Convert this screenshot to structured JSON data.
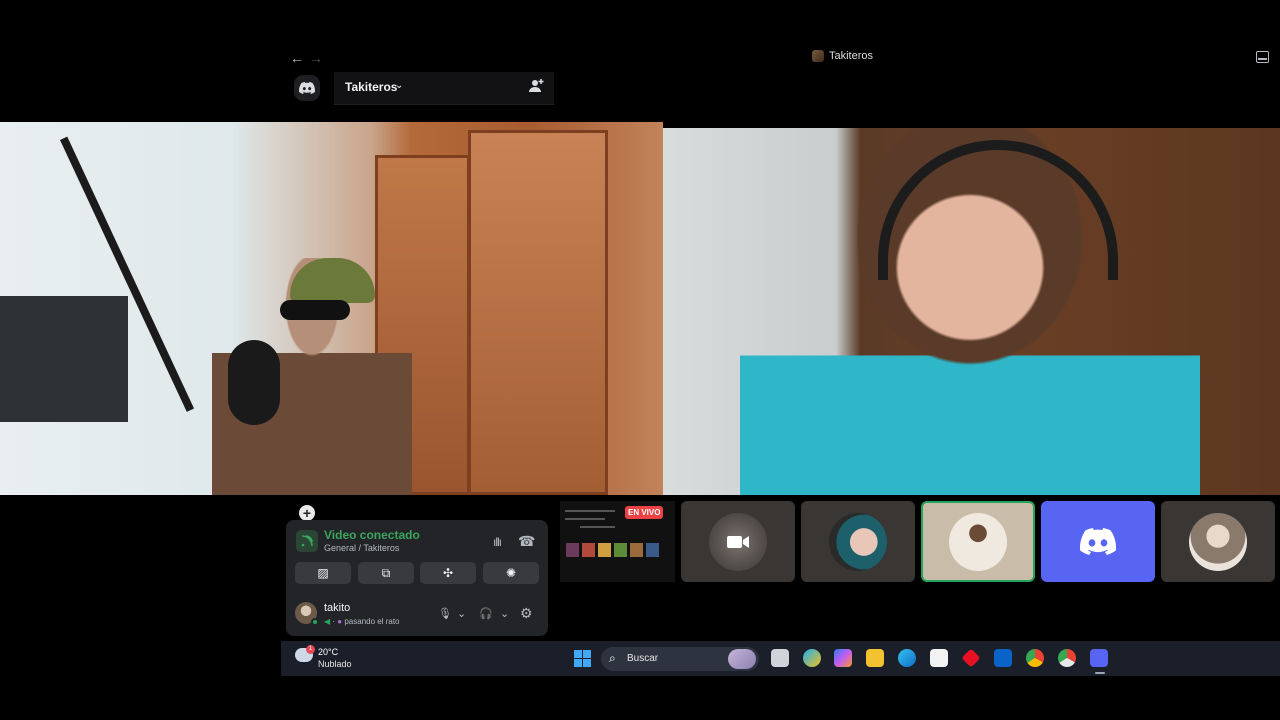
{
  "window": {
    "title": "Takiteros",
    "back_glyph": "←",
    "forward_glyph": "→"
  },
  "server": {
    "name": "Takiteros",
    "chevron": "⌄"
  },
  "voice_panel": {
    "add_glyph": "+",
    "status": "Video conectado",
    "channel": "General / Takiteros",
    "soundboard_glyph": "ıllı",
    "disconnect_glyph": "☎",
    "buttons": [
      {
        "name": "camera-off",
        "glyph": "▨"
      },
      {
        "name": "screen-share",
        "glyph": "⧉"
      },
      {
        "name": "activities",
        "glyph": "✣"
      },
      {
        "name": "soundboard",
        "glyph": "✺"
      }
    ]
  },
  "user": {
    "name": "takito",
    "activity": "pasando el rato",
    "mic_glyph": "🎙",
    "chevron": "⌄",
    "headset_glyph": "🎧",
    "settings_glyph": "⚙"
  },
  "stream": {
    "live_label": "EN VIVO"
  },
  "taskbar": {
    "weather_temp": "20°C",
    "weather_desc": "Nublado",
    "weather_badge": "1",
    "search_label": "Buscar",
    "search_glyph": "⌕"
  },
  "colors": {
    "voice_connected": "#3ba55d",
    "live": "#ed4245",
    "discord_blurple": "#5865f2",
    "speaking_border": "#23a55a"
  }
}
